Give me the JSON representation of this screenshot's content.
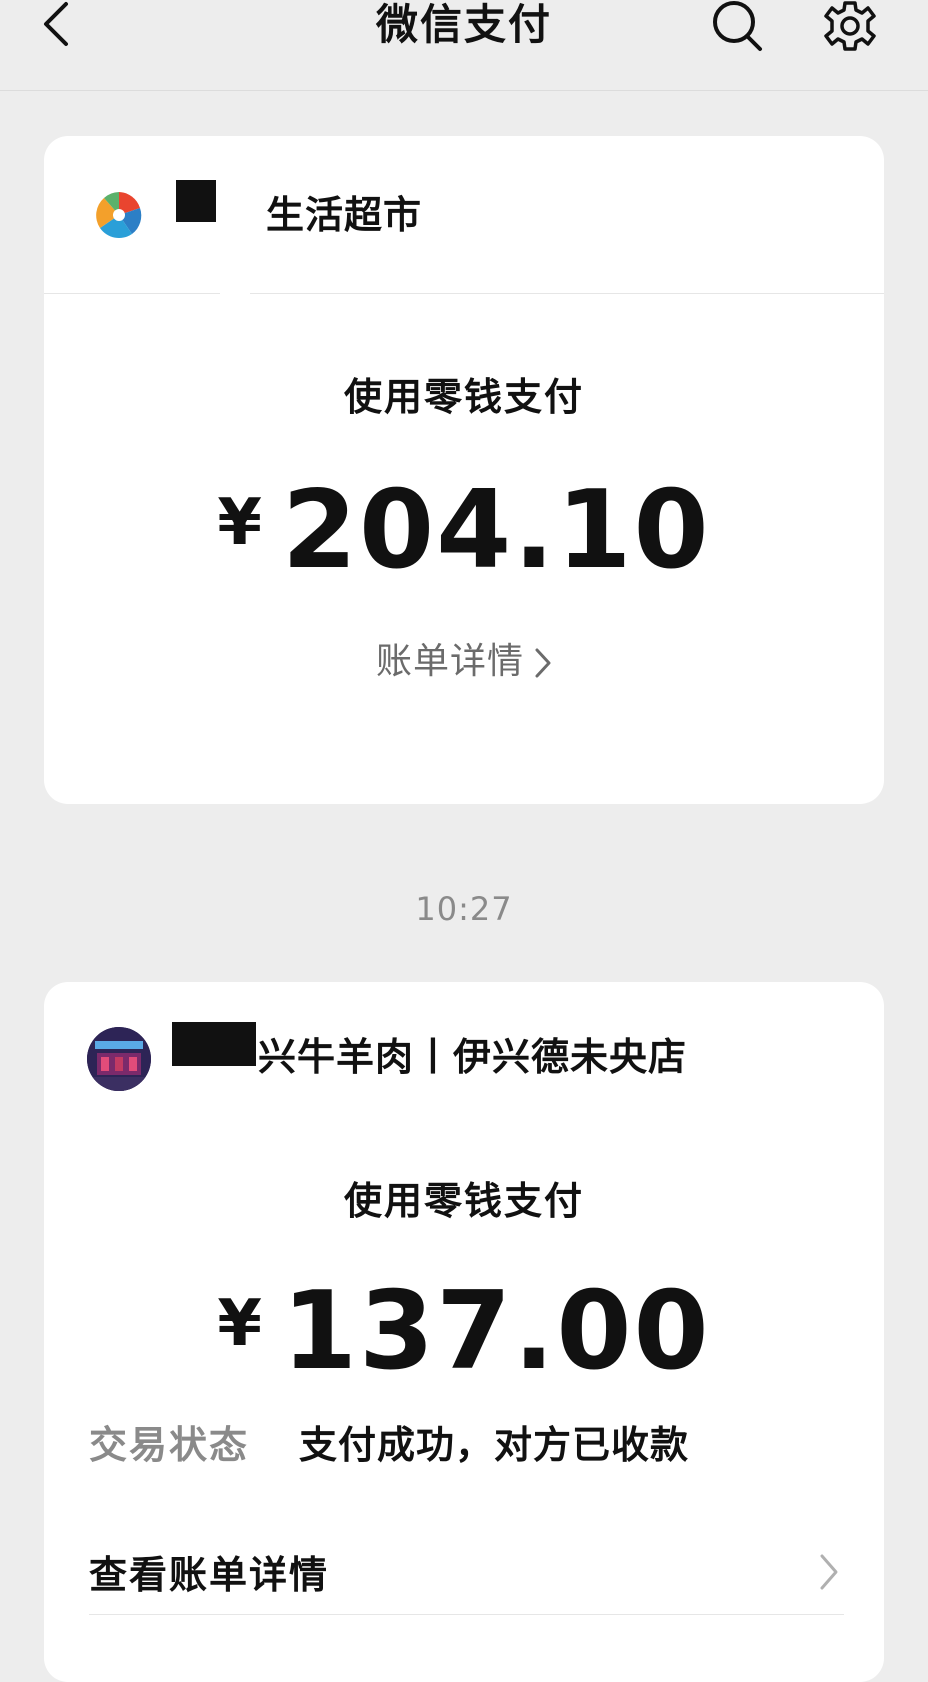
{
  "navbar": {
    "title": "微信支付",
    "back_icon": "chevron-left-icon",
    "search_icon": "search-icon",
    "settings_icon": "gear-icon"
  },
  "card1": {
    "merchant_name": "生活超市",
    "payment_method": "使用零钱支付",
    "currency_symbol": "¥",
    "amount": "204.10",
    "bill_link": "账单详情"
  },
  "time_label": "10:27",
  "card2": {
    "merchant_name": "兴牛羊肉丨伊兴德未央店",
    "payment_method": "使用零钱支付",
    "currency_symbol": "¥",
    "amount": "137.00",
    "status_label": "交易状态",
    "status_value": "支付成功，对方已收款",
    "view_bill": "查看账单详情"
  },
  "colors": {
    "background": "#ededed",
    "card": "#ffffff",
    "text": "#111111",
    "muted": "#8a8a8a"
  }
}
